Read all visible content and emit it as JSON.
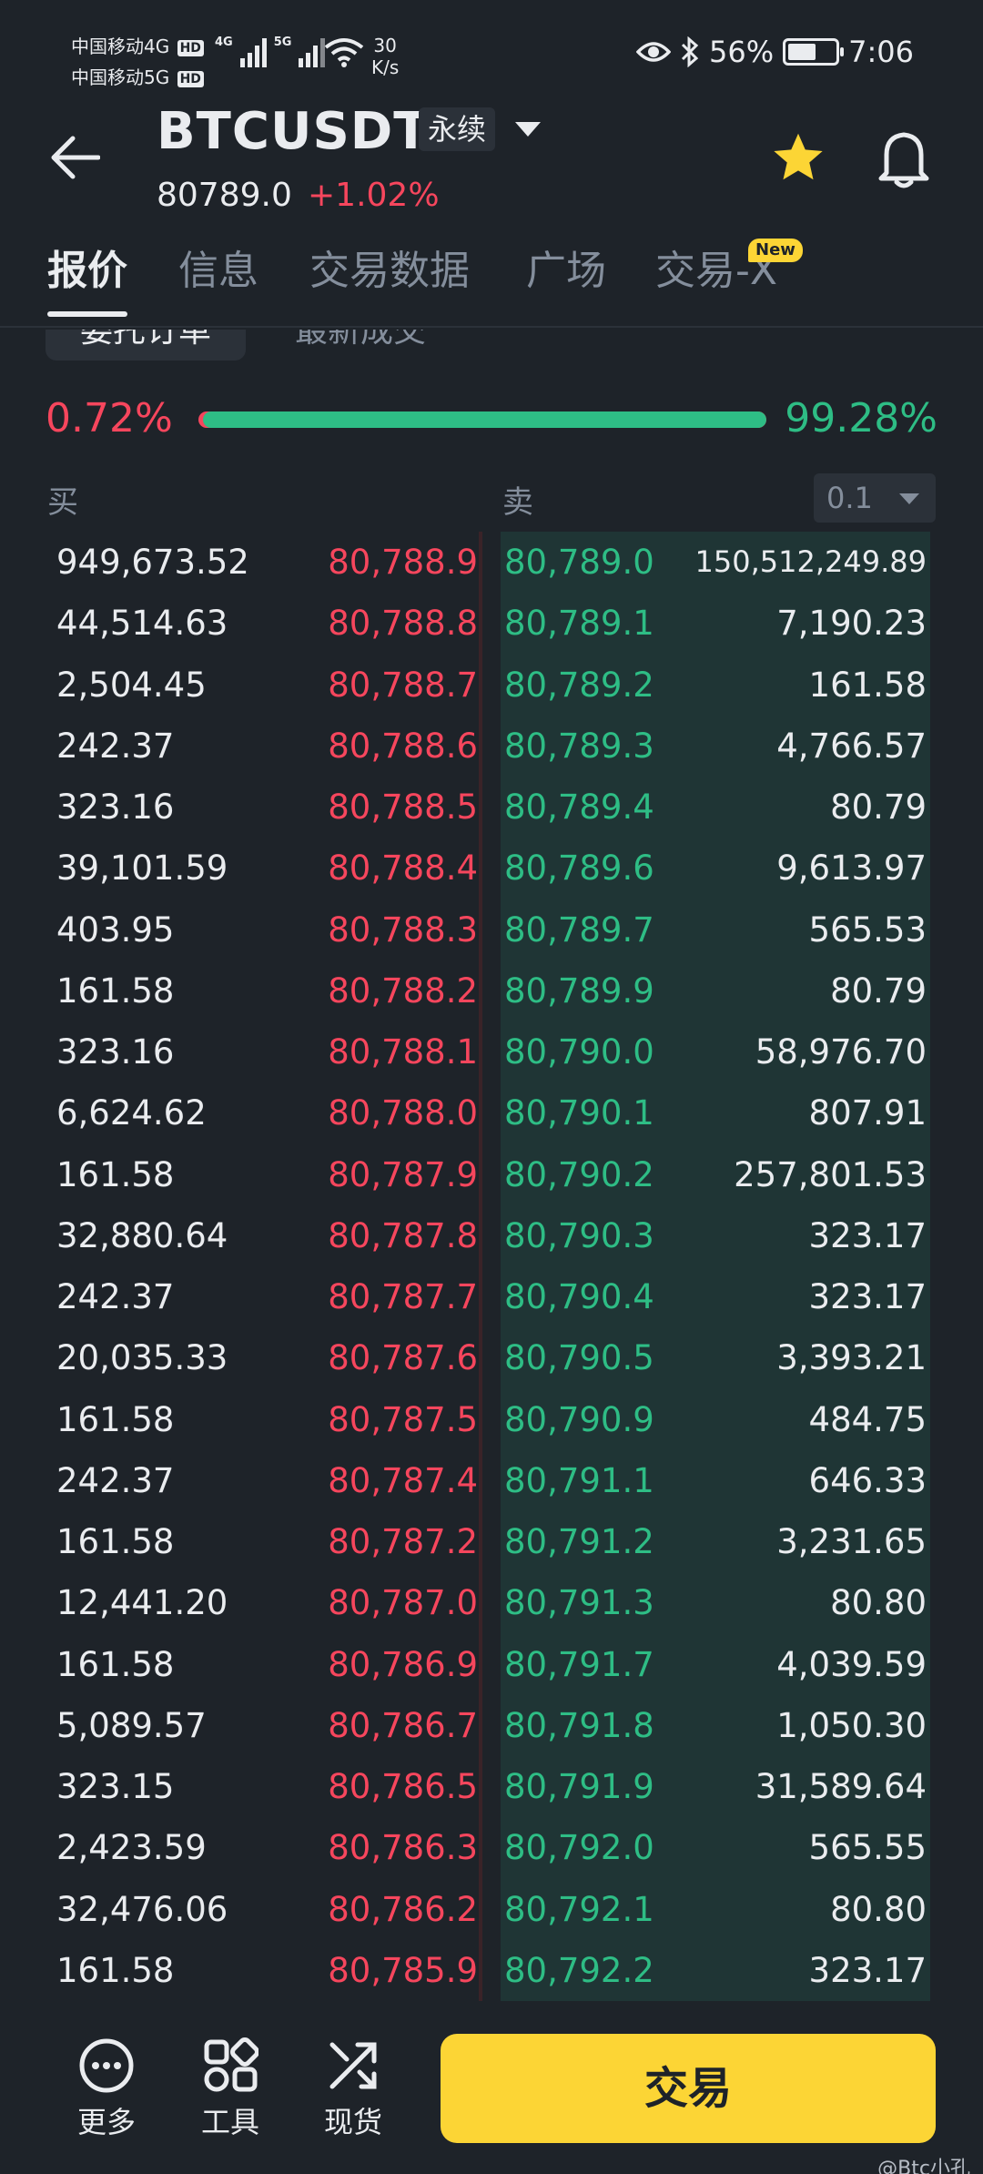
{
  "status_bar": {
    "carrier_1": "中国移动4G",
    "carrier_2": "中国移动5G",
    "hd": "HD",
    "net_4g": "4G",
    "net_5g": "5G",
    "speed_value": "30",
    "speed_unit": "K/s",
    "battery": "56%",
    "time": "7:06"
  },
  "header": {
    "symbol": "BTCUSDT",
    "contract_type": "永续",
    "last_price": "80789.0",
    "change_pct": "+1.02%"
  },
  "tabs": [
    "报价",
    "信息",
    "交易数据",
    "广场",
    "交易-X"
  ],
  "new_badge": "New",
  "sub_tabs": [
    "委托订单",
    "最新成交"
  ],
  "ratio": {
    "bid_label": "0.72%",
    "ask_label": "99.28%",
    "ask_fraction": 0.9928
  },
  "book_header": {
    "buy": "买",
    "sell": "卖",
    "precision": "0.1"
  },
  "order_book": [
    {
      "bid_qty": "949,673.52",
      "bid_price": "80,788.9",
      "ask_price": "80,789.0",
      "ask_qty": "150,512,249.89"
    },
    {
      "bid_qty": "44,514.63",
      "bid_price": "80,788.8",
      "ask_price": "80,789.1",
      "ask_qty": "7,190.23"
    },
    {
      "bid_qty": "2,504.45",
      "bid_price": "80,788.7",
      "ask_price": "80,789.2",
      "ask_qty": "161.58"
    },
    {
      "bid_qty": "242.37",
      "bid_price": "80,788.6",
      "ask_price": "80,789.3",
      "ask_qty": "4,766.57"
    },
    {
      "bid_qty": "323.16",
      "bid_price": "80,788.5",
      "ask_price": "80,789.4",
      "ask_qty": "80.79"
    },
    {
      "bid_qty": "39,101.59",
      "bid_price": "80,788.4",
      "ask_price": "80,789.6",
      "ask_qty": "9,613.97"
    },
    {
      "bid_qty": "403.95",
      "bid_price": "80,788.3",
      "ask_price": "80,789.7",
      "ask_qty": "565.53"
    },
    {
      "bid_qty": "161.58",
      "bid_price": "80,788.2",
      "ask_price": "80,789.9",
      "ask_qty": "80.79"
    },
    {
      "bid_qty": "323.16",
      "bid_price": "80,788.1",
      "ask_price": "80,790.0",
      "ask_qty": "58,976.70"
    },
    {
      "bid_qty": "6,624.62",
      "bid_price": "80,788.0",
      "ask_price": "80,790.1",
      "ask_qty": "807.91"
    },
    {
      "bid_qty": "161.58",
      "bid_price": "80,787.9",
      "ask_price": "80,790.2",
      "ask_qty": "257,801.53"
    },
    {
      "bid_qty": "32,880.64",
      "bid_price": "80,787.8",
      "ask_price": "80,790.3",
      "ask_qty": "323.17"
    },
    {
      "bid_qty": "242.37",
      "bid_price": "80,787.7",
      "ask_price": "80,790.4",
      "ask_qty": "323.17"
    },
    {
      "bid_qty": "20,035.33",
      "bid_price": "80,787.6",
      "ask_price": "80,790.5",
      "ask_qty": "3,393.21"
    },
    {
      "bid_qty": "161.58",
      "bid_price": "80,787.5",
      "ask_price": "80,790.9",
      "ask_qty": "484.75"
    },
    {
      "bid_qty": "242.37",
      "bid_price": "80,787.4",
      "ask_price": "80,791.1",
      "ask_qty": "646.33"
    },
    {
      "bid_qty": "161.58",
      "bid_price": "80,787.2",
      "ask_price": "80,791.2",
      "ask_qty": "3,231.65"
    },
    {
      "bid_qty": "12,441.20",
      "bid_price": "80,787.0",
      "ask_price": "80,791.3",
      "ask_qty": "80.80"
    },
    {
      "bid_qty": "161.58",
      "bid_price": "80,786.9",
      "ask_price": "80,791.7",
      "ask_qty": "4,039.59"
    },
    {
      "bid_qty": "5,089.57",
      "bid_price": "80,786.7",
      "ask_price": "80,791.8",
      "ask_qty": "1,050.30"
    },
    {
      "bid_qty": "323.15",
      "bid_price": "80,786.5",
      "ask_price": "80,791.9",
      "ask_qty": "31,589.64"
    },
    {
      "bid_qty": "2,423.59",
      "bid_price": "80,786.3",
      "ask_price": "80,792.0",
      "ask_qty": "565.55"
    },
    {
      "bid_qty": "32,476.06",
      "bid_price": "80,786.2",
      "ask_price": "80,792.1",
      "ask_qty": "80.80"
    },
    {
      "bid_qty": "161.58",
      "bid_price": "80,785.9",
      "ask_price": "80,792.2",
      "ask_qty": "323.17"
    }
  ],
  "bottom_bar": {
    "more": "更多",
    "tools": "工具",
    "spot": "现货",
    "trade": "交易"
  },
  "watermark": "@Btc小孔",
  "colors": {
    "background": "#1e2329",
    "up_green": "#2ebd85",
    "down_red": "#f6465d",
    "accent_yellow": "#fcd535"
  },
  "icons": [
    "back-arrow-icon",
    "caret-down-icon",
    "star-icon",
    "bell-icon",
    "more-icon",
    "tools-icon",
    "spot-icon",
    "eye-icon",
    "bluetooth-icon",
    "wifi-icon",
    "battery-icon"
  ]
}
